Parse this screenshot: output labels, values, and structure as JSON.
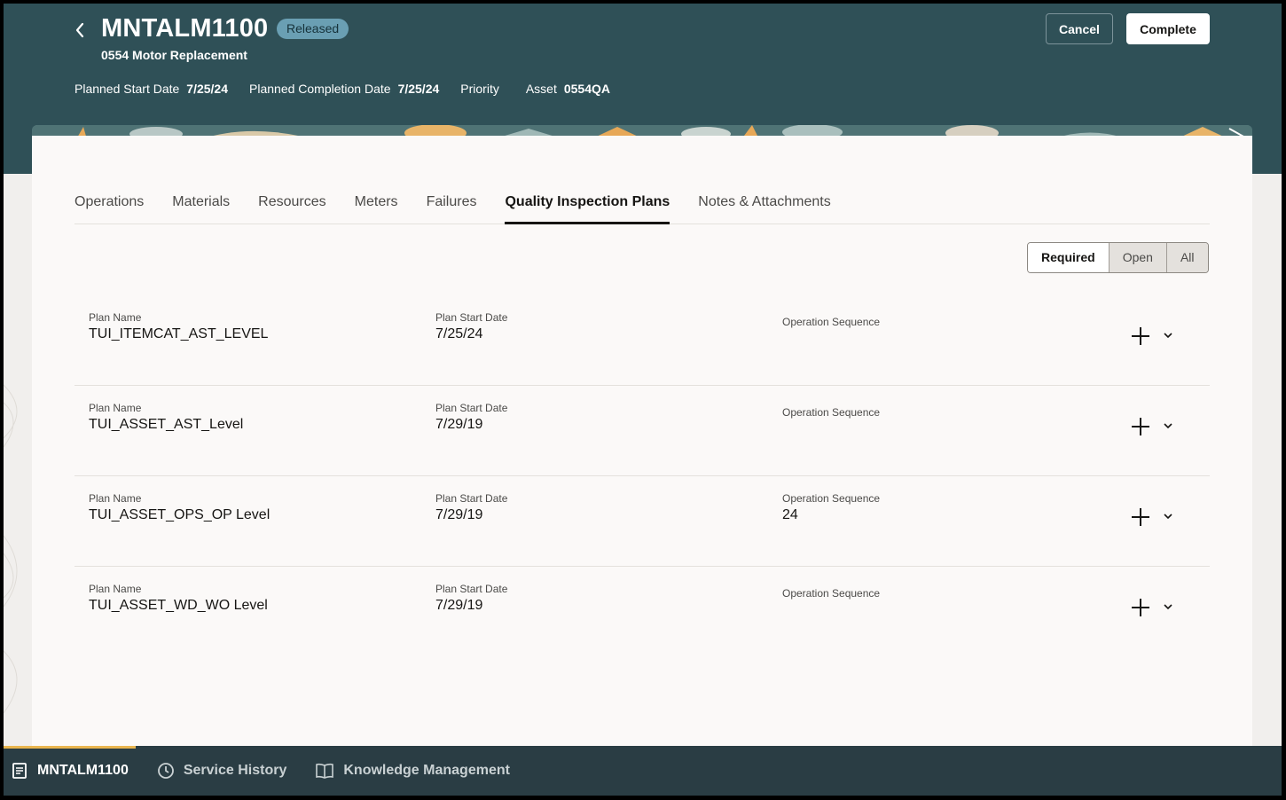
{
  "header": {
    "back_label": "Back",
    "title": "MNTALM1100",
    "status": "Released",
    "subtitle": "0554 Motor Replacement",
    "meta": {
      "planned_start_label": "Planned Start Date",
      "planned_start_value": "7/25/24",
      "planned_completion_label": "Planned Completion Date",
      "planned_completion_value": "7/25/24",
      "priority_label": "Priority",
      "asset_label": "Asset",
      "asset_value": "0554QA"
    },
    "cancel_label": "Cancel",
    "complete_label": "Complete"
  },
  "tabs": [
    {
      "label": "Operations"
    },
    {
      "label": "Materials"
    },
    {
      "label": "Resources"
    },
    {
      "label": "Meters"
    },
    {
      "label": "Failures"
    },
    {
      "label": "Quality Inspection Plans",
      "active": true
    },
    {
      "label": "Notes & Attachments"
    }
  ],
  "filter": {
    "required": "Required",
    "open": "Open",
    "all": "All",
    "selected": "Required"
  },
  "labels": {
    "plan_name": "Plan Name",
    "plan_start_date": "Plan Start Date",
    "operation_sequence": "Operation Sequence"
  },
  "plans": [
    {
      "name": "TUI_ITEMCAT_AST_LEVEL",
      "start": "7/25/24",
      "op_seq": ""
    },
    {
      "name": "TUI_ASSET_AST_Level",
      "start": "7/29/19",
      "op_seq": ""
    },
    {
      "name": "TUI_ASSET_OPS_OP Level",
      "start": "7/29/19",
      "op_seq": "24"
    },
    {
      "name": "TUI_ASSET_WD_WO Level",
      "start": "7/29/19",
      "op_seq": ""
    }
  ],
  "footer": {
    "tabs": [
      {
        "label": "MNTALM1100",
        "icon": "document-icon",
        "active": true
      },
      {
        "label": "Service History",
        "icon": "clock-icon"
      },
      {
        "label": "Knowledge Management",
        "icon": "book-icon"
      }
    ]
  },
  "colors": {
    "header_bg": "#2f5057",
    "footer_bg": "#2a3d44",
    "status_badge": "#6a9fb3",
    "footer_active_accent": "#e9b54f"
  }
}
